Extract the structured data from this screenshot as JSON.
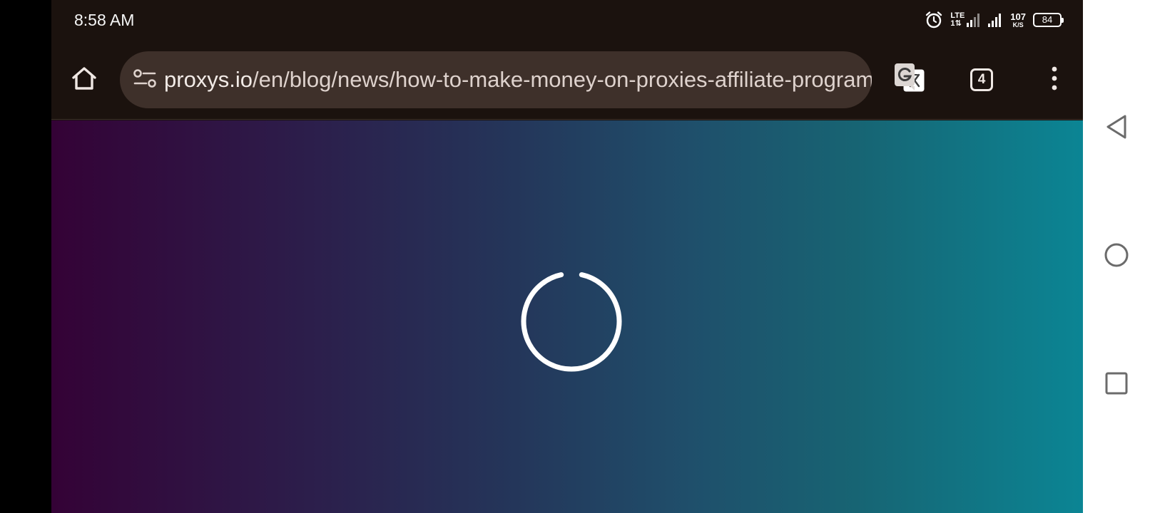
{
  "status_bar": {
    "time": "8:58 AM",
    "network_label_top": "LTE",
    "network_label_bottom": "1⇅",
    "speed_value": "107",
    "speed_unit": "K/S",
    "battery_level": "84",
    "icons": [
      "alarm-icon",
      "lte-signal-icon",
      "signal-icon",
      "battery-icon"
    ]
  },
  "toolbar": {
    "url": "proxys.io/en/blog/news/how-to-make-money-on-proxies-affiliate-programs",
    "url_host": "proxys.io",
    "url_path": "/en/blog/news/how-to-make-money-on-proxies-affiliate-programs",
    "tab_count": "4",
    "icons": [
      "home-icon",
      "site-settings-icon",
      "translate-icon",
      "tabs-icon",
      "more-vert-icon"
    ]
  },
  "content": {
    "state": "loading",
    "icons": [
      "loading-spinner-icon"
    ],
    "gradient_colors": [
      "#340236",
      "#24365a",
      "#0b8594"
    ]
  },
  "nav_bar": {
    "icons": [
      "back-icon",
      "home-circle-icon",
      "recents-icon"
    ]
  }
}
